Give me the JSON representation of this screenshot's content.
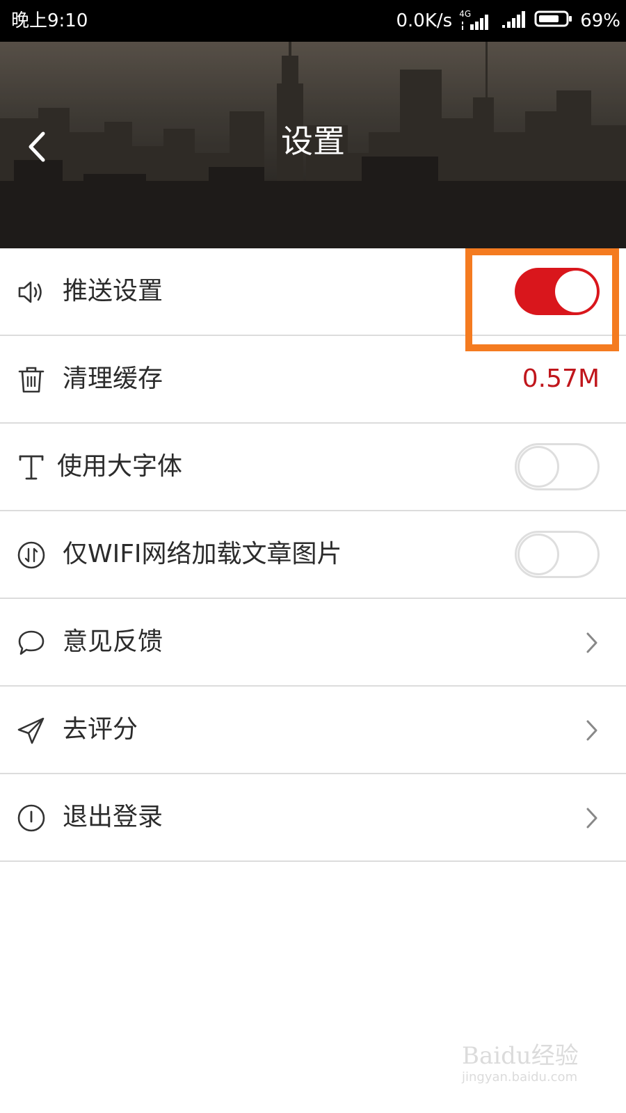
{
  "status_bar": {
    "time": "晚上9:10",
    "speed": "0.0K/s",
    "network": "4G",
    "battery": "69%"
  },
  "header": {
    "title": "设置",
    "back_icon": "chevron-left-icon"
  },
  "settings": {
    "items": [
      {
        "icon": "speaker-icon",
        "label": "推送设置",
        "control": "toggle",
        "on": true
      },
      {
        "icon": "trash-icon",
        "label": "清理缓存",
        "control": "value",
        "value": "0.57M"
      },
      {
        "icon": "font-icon",
        "label": "使用大字体",
        "control": "toggle",
        "on": false
      },
      {
        "icon": "wifi-image-icon",
        "label": "仅WIFI网络加载文章图片",
        "control": "toggle",
        "on": false
      },
      {
        "icon": "chat-bubble-icon",
        "label": "意见反馈",
        "control": "chevron"
      },
      {
        "icon": "paper-plane-icon",
        "label": "去评分",
        "control": "chevron"
      },
      {
        "icon": "logout-icon",
        "label": "退出登录",
        "control": "chevron"
      }
    ]
  },
  "colors": {
    "accent": "#d9161c",
    "highlight": "#f47b20"
  },
  "watermark": {
    "text": "Baidu经验",
    "url": "jingyan.baidu.com"
  }
}
